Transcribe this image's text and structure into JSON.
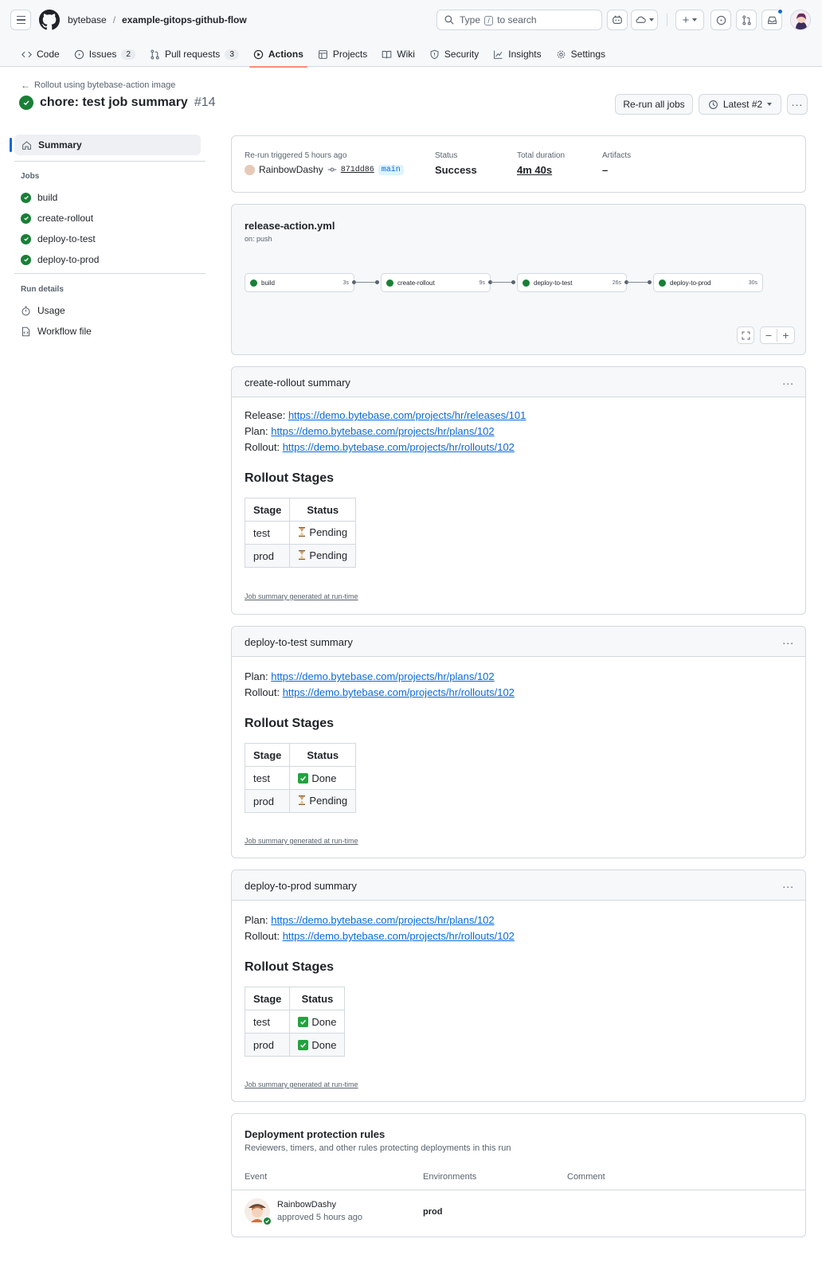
{
  "header": {
    "owner": "bytebase",
    "repo": "example-gitops-github-flow",
    "search_prefix": "Type",
    "search_key": "/",
    "search_suffix": "to search"
  },
  "tabs": [
    {
      "label": "Code",
      "icon": "code-icon"
    },
    {
      "label": "Issues",
      "count": "2",
      "icon": "issue-icon"
    },
    {
      "label": "Pull requests",
      "count": "3",
      "icon": "pull-request-icon"
    },
    {
      "label": "Actions",
      "icon": "play-icon",
      "active": true
    },
    {
      "label": "Projects",
      "icon": "table-icon"
    },
    {
      "label": "Wiki",
      "icon": "book-icon"
    },
    {
      "label": "Security",
      "icon": "shield-icon"
    },
    {
      "label": "Insights",
      "icon": "graph-icon"
    },
    {
      "label": "Settings",
      "icon": "gear-icon"
    }
  ],
  "run": {
    "back_label": "Rollout using bytebase-action image",
    "title": "chore: test job summary",
    "number": "#14",
    "rerun_label": "Re-run all jobs",
    "latest_label": "Latest #2"
  },
  "sidebar": {
    "summary": "Summary",
    "jobs_heading": "Jobs",
    "jobs": [
      "build",
      "create-rollout",
      "deploy-to-test",
      "deploy-to-prod"
    ],
    "details_heading": "Run details",
    "usage": "Usage",
    "workflow_file": "Workflow file"
  },
  "meta": {
    "trigger_label": "Re-run triggered 5 hours ago",
    "actor": "RainbowDashy",
    "sha": "871dd86",
    "branch": "main",
    "status_label": "Status",
    "status_value": "Success",
    "duration_label": "Total duration",
    "duration_value": "4m 40s",
    "artifacts_label": "Artifacts",
    "artifacts_value": "–"
  },
  "workflow": {
    "file": "release-action.yml",
    "trigger": "on: push",
    "jobs": [
      {
        "name": "build",
        "duration": "3s"
      },
      {
        "name": "create-rollout",
        "duration": "9s"
      },
      {
        "name": "deploy-to-test",
        "duration": "26s"
      },
      {
        "name": "deploy-to-prod",
        "duration": "30s"
      }
    ]
  },
  "summaries": [
    {
      "title": "create-rollout summary",
      "links": [
        {
          "label": "Release:",
          "url": "https://demo.bytebase.com/projects/hr/releases/101"
        },
        {
          "label": "Plan:",
          "url": "https://demo.bytebase.com/projects/hr/plans/102"
        },
        {
          "label": "Rollout:",
          "url": "https://demo.bytebase.com/projects/hr/rollouts/102"
        }
      ],
      "heading": "Rollout Stages",
      "columns": [
        "Stage",
        "Status"
      ],
      "rows": [
        {
          "stage": "test",
          "status": "Pending",
          "icon": "hourglass-icon"
        },
        {
          "stage": "prod",
          "status": "Pending",
          "icon": "hourglass-icon"
        }
      ],
      "footer": "Job summary generated at run-time"
    },
    {
      "title": "deploy-to-test summary",
      "links": [
        {
          "label": "Plan:",
          "url": "https://demo.bytebase.com/projects/hr/plans/102"
        },
        {
          "label": "Rollout:",
          "url": "https://demo.bytebase.com/projects/hr/rollouts/102"
        }
      ],
      "heading": "Rollout Stages",
      "columns": [
        "Stage",
        "Status"
      ],
      "rows": [
        {
          "stage": "test",
          "status": "Done",
          "icon": "check-mark-icon"
        },
        {
          "stage": "prod",
          "status": "Pending",
          "icon": "hourglass-icon"
        }
      ],
      "footer": "Job summary generated at run-time"
    },
    {
      "title": "deploy-to-prod summary",
      "links": [
        {
          "label": "Plan:",
          "url": "https://demo.bytebase.com/projects/hr/plans/102"
        },
        {
          "label": "Rollout:",
          "url": "https://demo.bytebase.com/projects/hr/rollouts/102"
        }
      ],
      "heading": "Rollout Stages",
      "columns": [
        "Stage",
        "Status"
      ],
      "rows": [
        {
          "stage": "test",
          "status": "Done",
          "icon": "check-mark-icon"
        },
        {
          "stage": "prod",
          "status": "Done",
          "icon": "check-mark-icon"
        }
      ],
      "footer": "Job summary generated at run-time"
    }
  ],
  "protection": {
    "title": "Deployment protection rules",
    "subtitle": "Reviewers, timers, and other rules protecting deployments in this run",
    "columns": [
      "Event",
      "Environments",
      "Comment"
    ],
    "rows": [
      {
        "actor": "RainbowDashy",
        "event": "approved 5 hours ago",
        "environment": "prod",
        "comment": ""
      }
    ]
  },
  "colors": {
    "success": "#1a7f37",
    "accent": "#0969da",
    "active_tab_underline": "#fd8c73"
  }
}
